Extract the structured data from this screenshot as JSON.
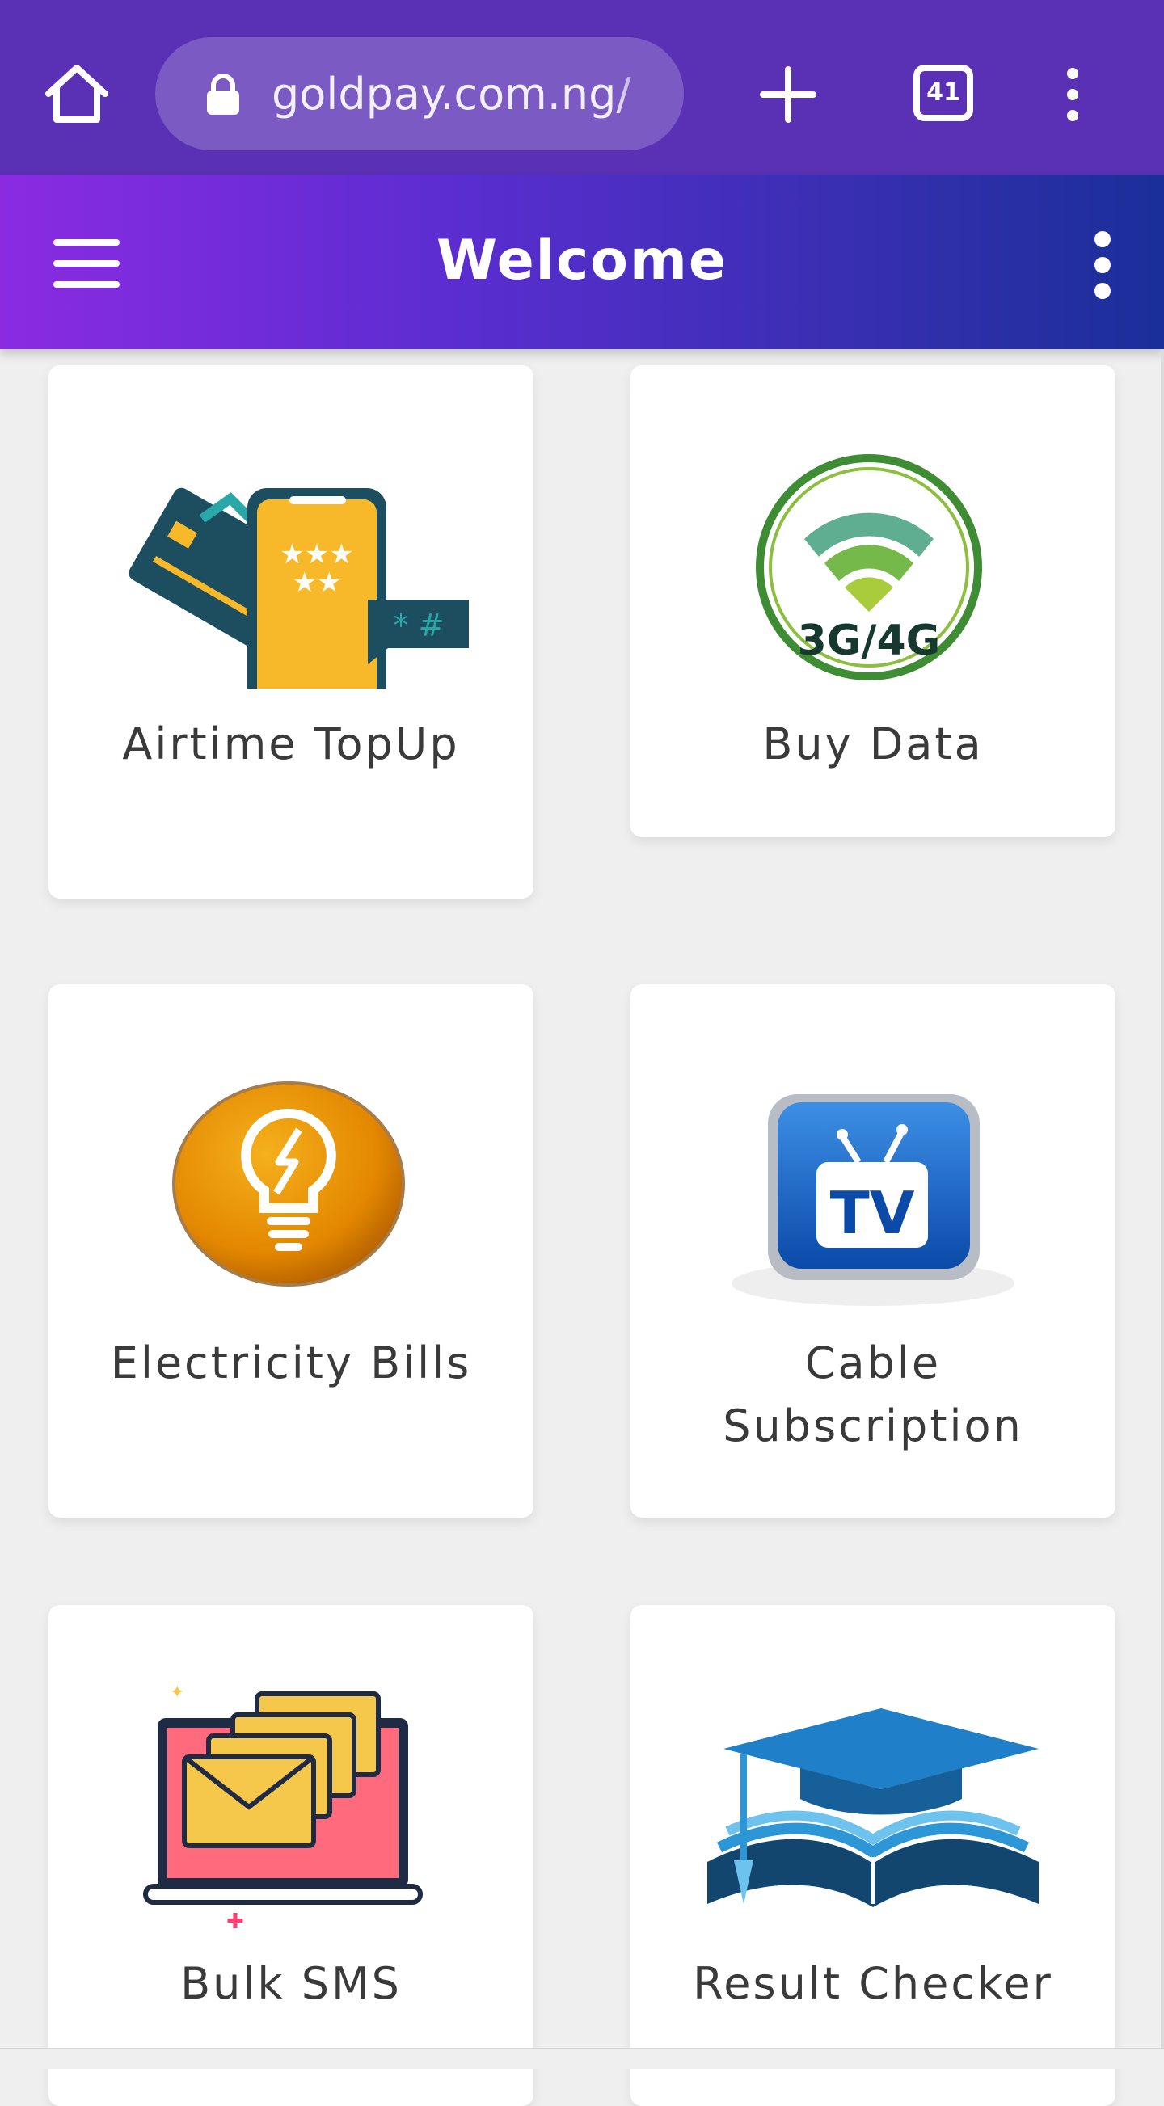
{
  "browser": {
    "url": "goldpay.com.ng/",
    "tab_count": "41"
  },
  "app_bar": {
    "title": "Welcome"
  },
  "services": [
    {
      "label": "Airtime TopUp",
      "icon": "phone-card-icon"
    },
    {
      "label": "Buy Data",
      "icon": "wifi-3g4g-icon"
    },
    {
      "label": "Electricity Bills",
      "icon": "lightbulb-icon"
    },
    {
      "label": "Cable Subscription",
      "icon": "tv-icon"
    },
    {
      "label": "Bulk SMS",
      "icon": "envelopes-laptop-icon"
    },
    {
      "label": "Result Checker",
      "icon": "graduation-book-icon"
    }
  ],
  "icons": {
    "airtime_art_text": "* #",
    "data_art_text": "3G/4G",
    "tv_art_text": "TV"
  },
  "colors": {
    "browser_bar": "#5a31b4",
    "app_bar_start": "#8a2be2",
    "app_bar_end": "#1a2f99",
    "background": "#efefef"
  }
}
